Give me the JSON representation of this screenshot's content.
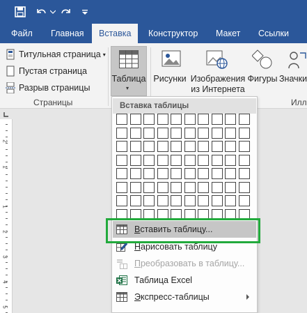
{
  "quick_access": {
    "save_icon": "save-icon",
    "undo_icon": "undo-icon",
    "redo_icon": "redo-icon",
    "customize_icon": "customize-icon"
  },
  "tabs": [
    {
      "label": "Файл",
      "active": false
    },
    {
      "label": "Главная",
      "active": false
    },
    {
      "label": "Вставка",
      "active": true
    },
    {
      "label": "Конструктор",
      "active": false
    },
    {
      "label": "Макет",
      "active": false
    },
    {
      "label": "Ссылки",
      "active": false
    }
  ],
  "ribbon": {
    "pages_group": {
      "title_page": "Титульная страница",
      "blank_page": "Пустая страница",
      "page_break": "Разрыв страницы",
      "label": "Страницы"
    },
    "table_button": {
      "label": "Таблица"
    },
    "pictures": "Рисунки",
    "online_pictures_line1": "Изображения",
    "online_pictures_line2": "из Интернета",
    "shapes": "Фигуры",
    "icons": "Значки",
    "illustrations_label": "Илл"
  },
  "ruler": {
    "numbers": [
      "2",
      "1",
      "1",
      "2",
      "3",
      "4",
      "5"
    ]
  },
  "dropdown": {
    "header": "Вставка таблицы",
    "grid": {
      "columns": 10,
      "rows": 8
    },
    "items": [
      {
        "label": "Вставить таблицу...",
        "accel": "В",
        "rest": "ставить таблицу...",
        "disabled": false,
        "highlighted": true,
        "submenu": false
      },
      {
        "label": "Нарисовать таблицу",
        "accel": "Н",
        "rest": "арисовать таблицу",
        "disabled": false,
        "highlighted": false,
        "submenu": false
      },
      {
        "label": "Преобразовать в таблицу...",
        "accel": "П",
        "rest": "реобразовать в таблицу...",
        "disabled": true,
        "highlighted": false,
        "submenu": false
      },
      {
        "label": "Таблица Excel",
        "accel": "",
        "rest": "Таблица Excel",
        "disabled": false,
        "highlighted": false,
        "submenu": false
      },
      {
        "label": "Экспресс-таблицы",
        "accel": "Э",
        "rest": "кспресс-таблицы",
        "disabled": false,
        "highlighted": false,
        "submenu": true
      }
    ]
  },
  "colors": {
    "brand": "#2b579a",
    "highlight_box": "#22aa3c",
    "excel_green": "#1e7145"
  }
}
